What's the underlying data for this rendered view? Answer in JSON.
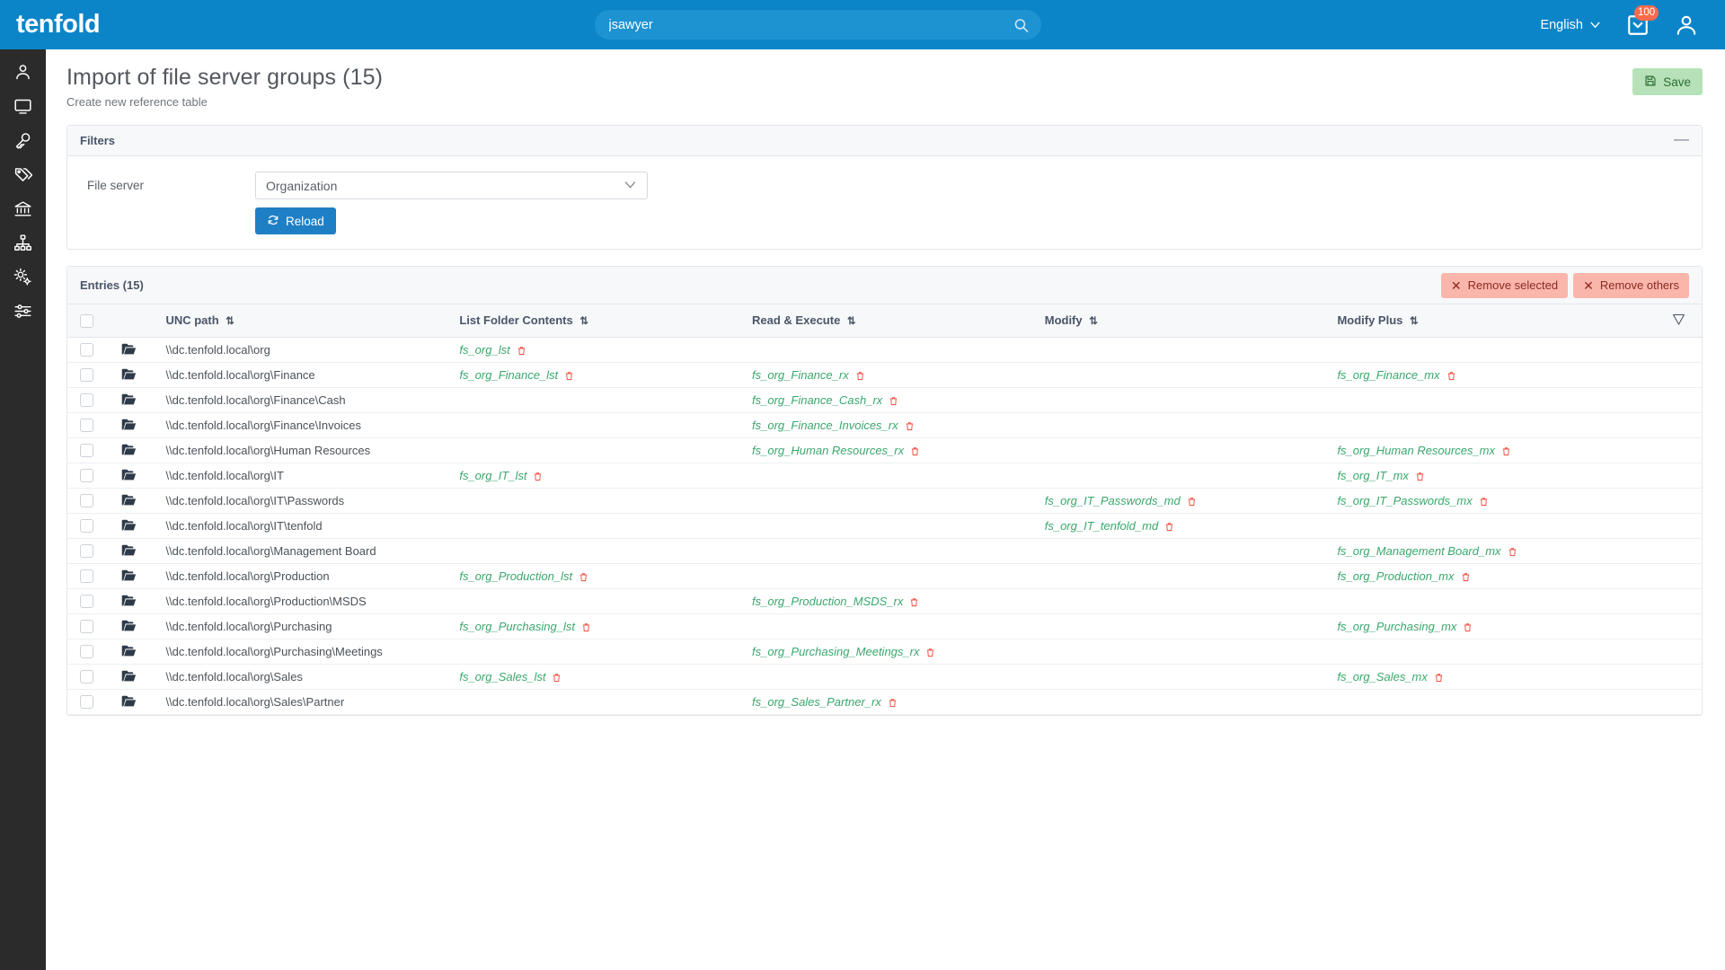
{
  "app": {
    "brand": "tenfold"
  },
  "topbar": {
    "search_value": "jsawyer",
    "search_placeholder": "Search",
    "language": "English",
    "inbox_badge": "100"
  },
  "sidebar": {
    "items": [
      {
        "name": "users",
        "icon": "user-icon"
      },
      {
        "name": "systems",
        "icon": "monitor-icon"
      },
      {
        "name": "permissions",
        "icon": "key-icon"
      },
      {
        "name": "tags",
        "icon": "tags-icon"
      },
      {
        "name": "organizations",
        "icon": "bank-icon"
      },
      {
        "name": "hierarchy",
        "icon": "sitemap-icon"
      },
      {
        "name": "configuration",
        "icon": "gears-icon"
      },
      {
        "name": "settings",
        "icon": "sliders-icon"
      }
    ]
  },
  "page": {
    "title": "Import of file server groups (15)",
    "subtitle": "Create new reference table",
    "save_label": "Save"
  },
  "filters": {
    "title": "Filters",
    "collapse_glyph": "—",
    "file_server_label": "File server",
    "file_server_value": "Organization",
    "reload_label": "Reload"
  },
  "entries": {
    "title": "Entries (15)",
    "remove_selected_label": "Remove selected",
    "remove_others_label": "Remove others",
    "x_glyph": "✕",
    "sort_glyph": "⇅",
    "columns": [
      "UNC path",
      "List Folder Contents",
      "Read & Execute",
      "Modify",
      "Modify Plus"
    ],
    "rows": [
      {
        "unc": "\\\\dc.tenfold.local\\org",
        "lst": "fs_org_lst",
        "rx": "",
        "md": "",
        "mx": ""
      },
      {
        "unc": "\\\\dc.tenfold.local\\org\\Finance",
        "lst": "fs_org_Finance_lst",
        "rx": "fs_org_Finance_rx",
        "md": "",
        "mx": "fs_org_Finance_mx"
      },
      {
        "unc": "\\\\dc.tenfold.local\\org\\Finance\\Cash",
        "lst": "",
        "rx": "fs_org_Finance_Cash_rx",
        "md": "",
        "mx": ""
      },
      {
        "unc": "\\\\dc.tenfold.local\\org\\Finance\\Invoices",
        "lst": "",
        "rx": "fs_org_Finance_Invoices_rx",
        "md": "",
        "mx": ""
      },
      {
        "unc": "\\\\dc.tenfold.local\\org\\Human Resources",
        "lst": "",
        "rx": "fs_org_Human Resources_rx",
        "md": "",
        "mx": "fs_org_Human Resources_mx"
      },
      {
        "unc": "\\\\dc.tenfold.local\\org\\IT",
        "lst": "fs_org_IT_lst",
        "rx": "",
        "md": "",
        "mx": "fs_org_IT_mx"
      },
      {
        "unc": "\\\\dc.tenfold.local\\org\\IT\\Passwords",
        "lst": "",
        "rx": "",
        "md": "fs_org_IT_Passwords_md",
        "mx": "fs_org_IT_Passwords_mx"
      },
      {
        "unc": "\\\\dc.tenfold.local\\org\\IT\\tenfold",
        "lst": "",
        "rx": "",
        "md": "fs_org_IT_tenfold_md",
        "mx": ""
      },
      {
        "unc": "\\\\dc.tenfold.local\\org\\Management Board",
        "lst": "",
        "rx": "",
        "md": "",
        "mx": "fs_org_Management Board_mx"
      },
      {
        "unc": "\\\\dc.tenfold.local\\org\\Production",
        "lst": "fs_org_Production_lst",
        "rx": "",
        "md": "",
        "mx": "fs_org_Production_mx"
      },
      {
        "unc": "\\\\dc.tenfold.local\\org\\Production\\MSDS",
        "lst": "",
        "rx": "fs_org_Production_MSDS_rx",
        "md": "",
        "mx": ""
      },
      {
        "unc": "\\\\dc.tenfold.local\\org\\Purchasing",
        "lst": "fs_org_Purchasing_lst",
        "rx": "",
        "md": "",
        "mx": "fs_org_Purchasing_mx"
      },
      {
        "unc": "\\\\dc.tenfold.local\\org\\Purchasing\\Meetings",
        "lst": "",
        "rx": "fs_org_Purchasing_Meetings_rx",
        "md": "",
        "mx": ""
      },
      {
        "unc": "\\\\dc.tenfold.local\\org\\Sales",
        "lst": "fs_org_Sales_lst",
        "rx": "",
        "md": "",
        "mx": "fs_org_Sales_mx"
      },
      {
        "unc": "\\\\dc.tenfold.local\\org\\Sales\\Partner",
        "lst": "",
        "rx": "fs_org_Sales_Partner_rx",
        "md": "",
        "mx": ""
      }
    ]
  },
  "colors": {
    "brand_blue": "#0b85c8",
    "sidebar": "#2b2b2b",
    "group_green": "#3aa76d",
    "trash_red": "#f0483a",
    "save_green_bg": "#b7e2b9",
    "danger_bg": "#fbb6ab",
    "badge_orange": "#fd6a4d"
  }
}
